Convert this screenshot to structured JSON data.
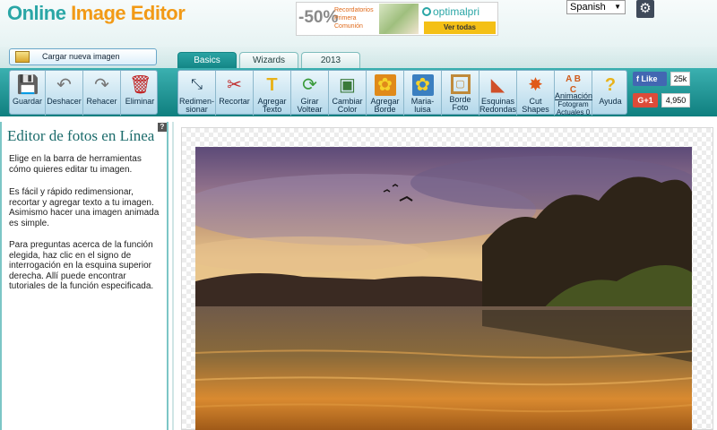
{
  "header": {
    "logo_part1": "Online ",
    "logo_part2": "Image Editor",
    "language": "Spanish"
  },
  "ad": {
    "discount": "-50%",
    "text": "Recordatorios Primera Comunión",
    "brand": "optimalpri",
    "button": "Ver todas"
  },
  "upload_button": "Cargar nueva imagen",
  "tabs": [
    {
      "label": "Basics",
      "active": true
    },
    {
      "label": "Wizards",
      "active": false
    },
    {
      "label": "2013",
      "active": false
    }
  ],
  "toolbar": {
    "guardar": "Guardar",
    "deshacer": "Deshacer",
    "rehacer": "Rehacer",
    "eliminar": "Eliminar",
    "redimensionar_1": "Redimen-",
    "redimensionar_2": "sionar",
    "recortar": "Recortar",
    "agregar_texto_1": "Agregar",
    "agregar_texto_2": "Texto",
    "girar_1": "Girar",
    "girar_2": "Voltear",
    "cambiar_1": "Cambiar",
    "cambiar_2": "Color",
    "borde_1": "Agregar",
    "borde_2": "Borde",
    "marialuisa_1": "Maria-",
    "marialuisa_2": "luisa",
    "bordefoto_1": "Borde",
    "bordefoto_2": "Foto",
    "esquinas_1": "Esquinas",
    "esquinas_2": "Redondas",
    "cut_1": "Cut",
    "cut_2": "Shapes",
    "animacion": "Animación",
    "fotogram_1": "Fotogram",
    "fotogram_2": "Actuales 0",
    "ayuda": "Ayuda"
  },
  "social": {
    "fb_label": "Like",
    "fb_count": "25k",
    "gp_label": "G+1",
    "gp_count": "4,950"
  },
  "left_panel": {
    "title": "Editor de fotos en Línea",
    "p1": "Elige en la barra de herramientas cómo quieres editar tu imagen.",
    "p2": "Es fácil y rápido redimensionar, recortar y agregar texto a tu imagen. Asimismo hacer una imagen animada es simple.",
    "p3": "Para preguntas acerca de la función elegida, haz clic en el signo de interrogación en la esquina superior derecha. Allí puede encontrar tutoriales de la función especificada.",
    "help_mark": "?"
  },
  "colors": {
    "teal": "#138686",
    "orange": "#f29a16"
  }
}
